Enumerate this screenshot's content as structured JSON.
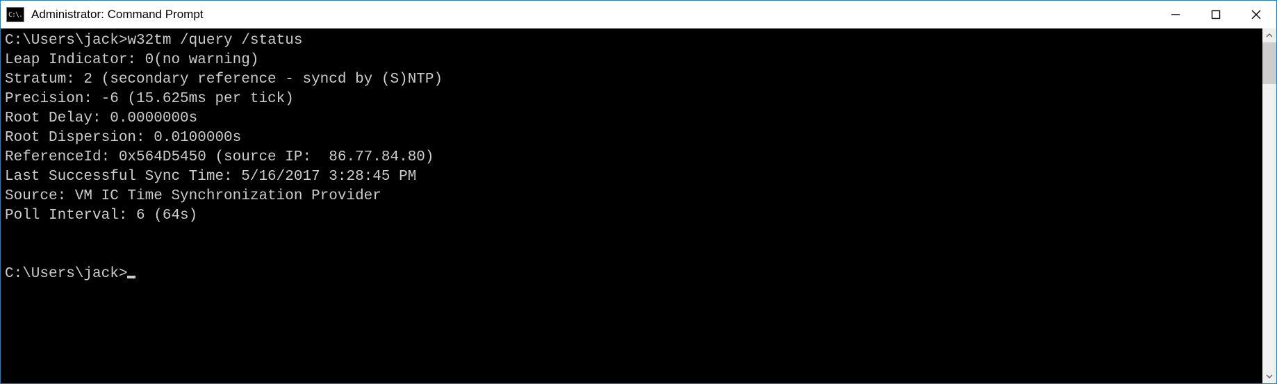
{
  "window": {
    "title": "Administrator: Command Prompt",
    "icon_text": "C:\\."
  },
  "terminal": {
    "prompt1_path": "C:\\Users\\jack>",
    "command": "w32tm /query /status",
    "output": {
      "leap_indicator": "Leap Indicator: 0(no warning)",
      "stratum": "Stratum: 2 (secondary reference - syncd by (S)NTP)",
      "precision": "Precision: -6 (15.625ms per tick)",
      "root_delay": "Root Delay: 0.0000000s",
      "root_dispersion": "Root Dispersion: 0.0100000s",
      "reference_id": "ReferenceId: 0x564D5450 (source IP:  86.77.84.80)",
      "last_sync": "Last Successful Sync Time: 5/16/2017 3:28:45 PM",
      "source": "Source: VM IC Time Synchronization Provider",
      "poll_interval": "Poll Interval: 6 (64s)"
    },
    "prompt2_path": "C:\\Users\\jack>"
  }
}
